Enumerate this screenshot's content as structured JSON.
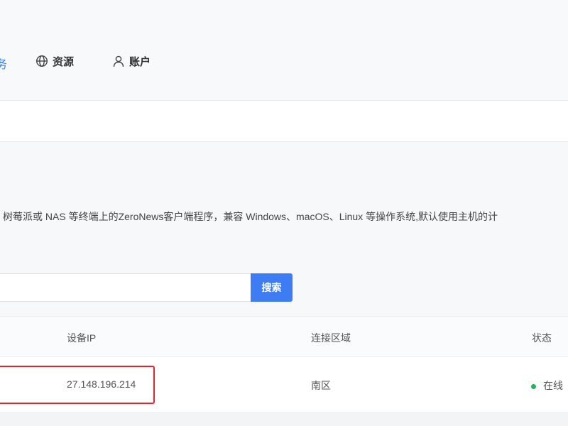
{
  "nav": {
    "cut_item": "务",
    "items": [
      {
        "label": "资源",
        "icon": "globe-icon"
      },
      {
        "label": "账户",
        "icon": "user-icon"
      }
    ]
  },
  "description": "树莓派或 NAS 等终端上的ZeroNews客户端程序，兼容 Windows、macOS、Linux 等操作系统,默认使用主机的计",
  "search": {
    "placeholder": "",
    "value": "",
    "button_label": "搜索"
  },
  "table": {
    "columns": [
      "设备IP",
      "连接区域",
      "状态"
    ],
    "rows": [
      {
        "ip": "27.148.196.214",
        "region": "南区",
        "status": "在线"
      }
    ]
  },
  "colors": {
    "accent": "#3d7cf2",
    "highlight": "#e8222c",
    "online": "#22b35e"
  }
}
